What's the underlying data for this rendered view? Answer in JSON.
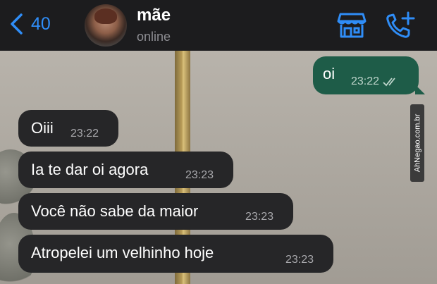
{
  "header": {
    "back_count": "40",
    "contact_name": "mãe",
    "contact_status": "online"
  },
  "messages": [
    {
      "direction": "out",
      "text": "oi",
      "time": "23:22",
      "read_receipt": "double-check-icon"
    },
    {
      "direction": "in",
      "text": "Oiii",
      "time": "23:22"
    },
    {
      "direction": "in",
      "text": "Ia te dar oi agora",
      "time": "23:23"
    },
    {
      "direction": "in",
      "text": "Você não sabe da maior",
      "time": "23:23"
    },
    {
      "direction": "in",
      "text": "Atropelei um velhinho hoje",
      "time": "23:23"
    }
  ],
  "watermark": {
    "text": "AhNegao.com.br"
  },
  "colors": {
    "accent": "#2f8df7",
    "header_bg": "#1c1c1e",
    "incoming_bubble": "#262628",
    "outgoing_bubble": "#1e5c48"
  },
  "icons": [
    "chevron-left-icon",
    "store-icon",
    "call-add-icon",
    "double-check-icon"
  ]
}
